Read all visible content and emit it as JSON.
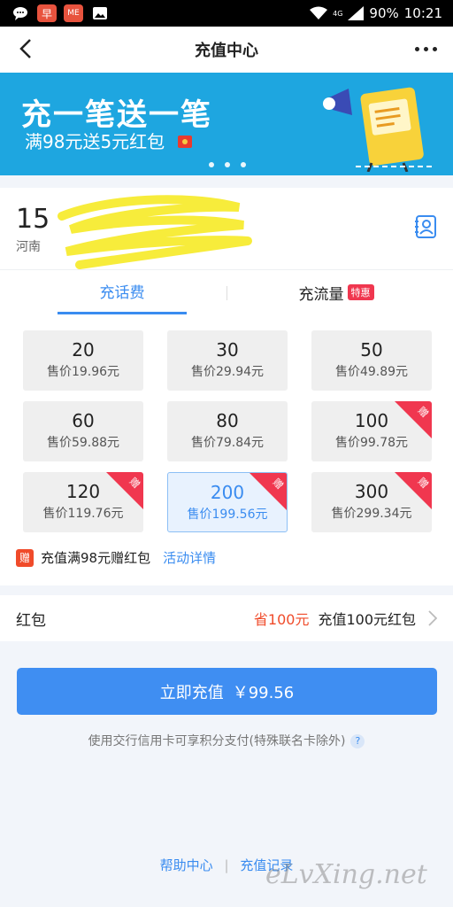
{
  "status_bar": {
    "battery": "90%",
    "time": "10:21",
    "network": "4G"
  },
  "nav": {
    "title": "充值中心"
  },
  "banner": {
    "title": "充一笔送一笔",
    "subtitle": "满98元送5元红包"
  },
  "phone": {
    "number_visible": "15",
    "sub_visible": "河南"
  },
  "tabs": [
    {
      "label": "充话费"
    },
    {
      "label": "充流量",
      "badge": "特惠"
    }
  ],
  "cards": [
    {
      "amount": "20",
      "price": "售价19.96元"
    },
    {
      "amount": "30",
      "price": "售价29.94元"
    },
    {
      "amount": "50",
      "price": "售价49.89元"
    },
    {
      "amount": "60",
      "price": "售价59.88元"
    },
    {
      "amount": "80",
      "price": "售价79.84元"
    },
    {
      "amount": "100",
      "price": "售价99.78元",
      "ribbon": "赠"
    },
    {
      "amount": "120",
      "price": "售价119.76元",
      "ribbon": "赠"
    },
    {
      "amount": "200",
      "price": "售价199.56元",
      "ribbon": "赠"
    },
    {
      "amount": "300",
      "price": "售价299.34元",
      "ribbon": "赠"
    }
  ],
  "promo": {
    "icon_text": "赠",
    "text": "充值满98元赠红包",
    "link": "活动详情"
  },
  "red_packet": {
    "label": "红包",
    "save": "省100元",
    "desc": "充值100元红包"
  },
  "pay": {
    "label": "立即充值",
    "amount": "￥99.56"
  },
  "note": {
    "text": "使用交行信用卡可享积分支付(特殊联名卡除外)",
    "help": "?"
  },
  "footer": {
    "help": "帮助中心",
    "records": "充值记录"
  },
  "watermark": "eLvXing.net",
  "colors": {
    "accent": "#3a8cf0",
    "banner": "#1ea6e0",
    "red": "#f0374f"
  }
}
